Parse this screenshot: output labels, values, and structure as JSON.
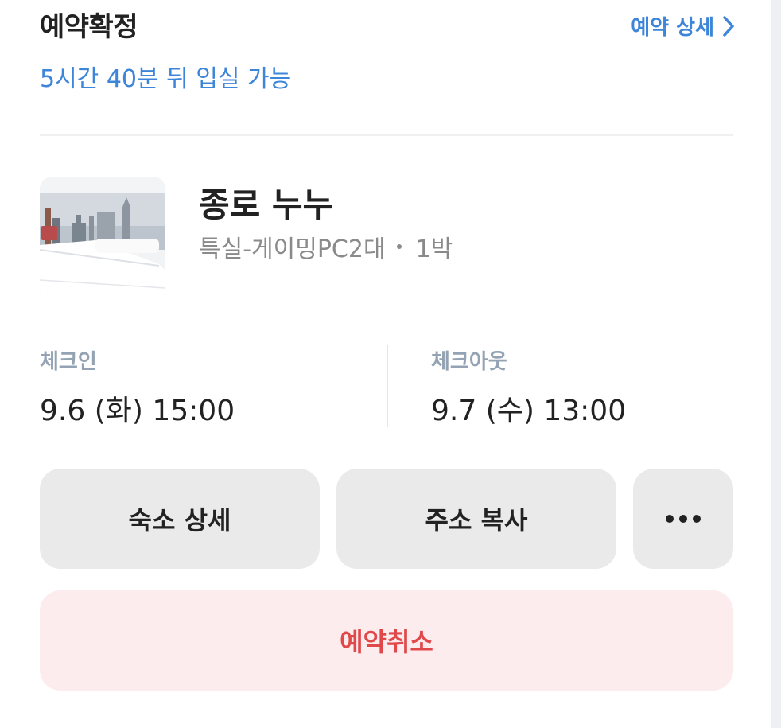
{
  "reservation": {
    "status_title": "예약확정",
    "detail_link_label": "예약 상세",
    "time_notice": "5시간 40분 뒤 입실 가능"
  },
  "hotel": {
    "name": "종로 누누",
    "room_type": "특실-게이밍PC2대",
    "nights": "1박",
    "thumbnail_icon": "hotel-room-photo"
  },
  "stay": {
    "checkin_label": "체크인",
    "checkin_value": "9.6 (화) 15:00",
    "checkout_label": "체크아웃",
    "checkout_value": "9.7 (수) 13:00"
  },
  "actions": {
    "property_detail_label": "숙소 상세",
    "copy_address_label": "주소 복사",
    "more_icon": "more-horizontal-icon",
    "cancel_label": "예약취소"
  },
  "colors": {
    "accent_blue": "#3d85d8",
    "cancel_red": "#e0484a",
    "cancel_bg": "#fdeced",
    "button_bg": "#eaeaea",
    "label_gray": "#94a3b3"
  }
}
